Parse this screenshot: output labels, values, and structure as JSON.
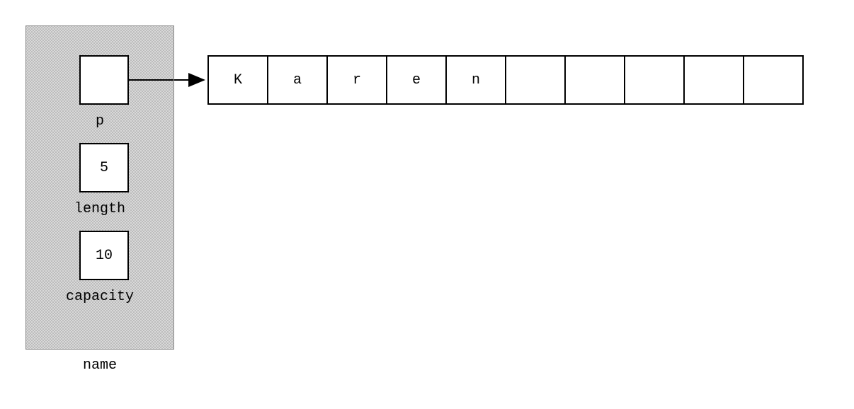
{
  "struct": {
    "name_label": "name",
    "fields": {
      "p": {
        "label": "p",
        "value": ""
      },
      "length": {
        "label": "length",
        "value": "5"
      },
      "capacity": {
        "label": "capacity",
        "value": "10"
      }
    }
  },
  "array": {
    "capacity": 10,
    "cells": [
      "K",
      "a",
      "r",
      "e",
      "n",
      "",
      "",
      "",
      "",
      ""
    ]
  },
  "chart_data": {
    "type": "diagram",
    "description": "Memory layout of a string-like struct pointing to a backing character array",
    "struct_fields": [
      {
        "name": "p",
        "kind": "pointer",
        "points_to": "array"
      },
      {
        "name": "length",
        "kind": "int",
        "value": 5
      },
      {
        "name": "capacity",
        "kind": "int",
        "value": 10
      }
    ],
    "array_contents": [
      "K",
      "a",
      "r",
      "e",
      "n",
      "",
      "",
      "",
      "",
      ""
    ],
    "struct_variable_name": "name"
  }
}
